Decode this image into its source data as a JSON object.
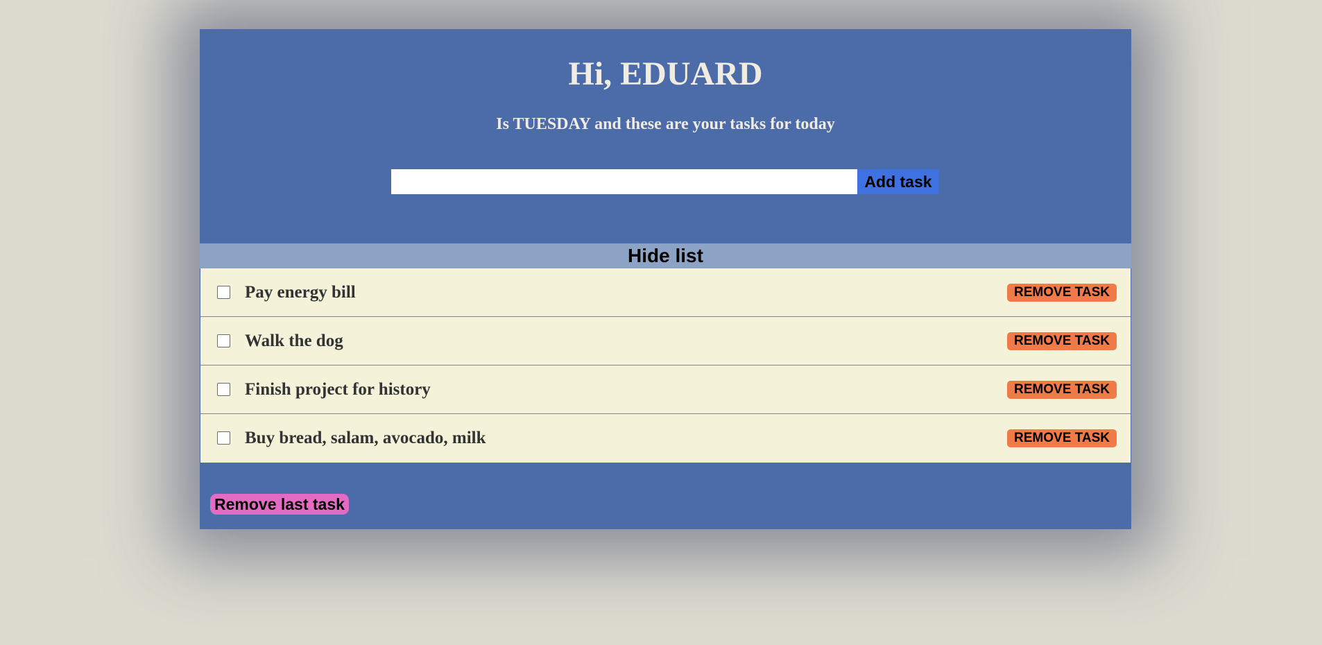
{
  "header": {
    "greeting": "Hi, EDUARD",
    "subtitle": "Is TUESDAY and these are your tasks for today"
  },
  "add_task": {
    "input_value": "",
    "button_label": "Add task"
  },
  "list_toggle": {
    "label": "Hide list"
  },
  "tasks": [
    {
      "text": "Pay energy bill",
      "checked": false,
      "remove_label": "REMOVE TASK"
    },
    {
      "text": "Walk the dog",
      "checked": false,
      "remove_label": "REMOVE TASK"
    },
    {
      "text": "Finish project for history",
      "checked": false,
      "remove_label": "REMOVE TASK"
    },
    {
      "text": "Buy bread, salam, avocado, milk",
      "checked": false,
      "remove_label": "REMOVE TASK"
    }
  ],
  "footer": {
    "remove_last_label": "Remove last task"
  },
  "colors": {
    "page_background": "#dcdbd0",
    "card_background": "#4b6ca8",
    "toggle_bar": "#8da3c5",
    "task_background": "#f4f3da",
    "add_button": "#3f72e0",
    "remove_button": "#f07a48",
    "remove_last_button": "#e46bc4"
  }
}
